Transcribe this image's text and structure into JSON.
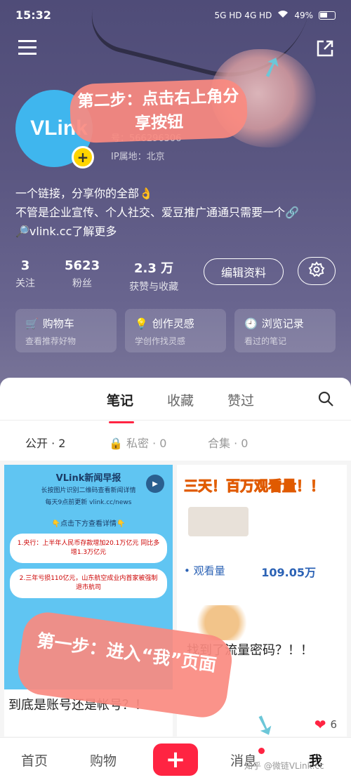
{
  "status_bar": {
    "time": "15:32",
    "network": "5G HD  4G HD",
    "battery": "49%"
  },
  "profile": {
    "avatar_text": "VLink",
    "id_text": "号：566296306",
    "ip_text": "IP属地：北京",
    "bio_lines": [
      "一个链接，分享你的全部👌",
      "不管是企业宣传、个人社交、爱豆推广通通只需要一个🔗",
      "🔎vlink.cc了解更多"
    ],
    "stats": [
      {
        "num": "3",
        "label": "关注"
      },
      {
        "num": "5623",
        "label": "粉丝"
      },
      {
        "num": "2.3 万",
        "label": "获赞与收藏"
      }
    ],
    "edit_label": "编辑资料"
  },
  "cards": [
    {
      "title": "购物车",
      "sub": "查看推荐好物"
    },
    {
      "title": "创作灵感",
      "sub": "学创作找灵感"
    },
    {
      "title": "浏览记录",
      "sub": "看过的笔记"
    }
  ],
  "tabs": [
    {
      "label": "笔记"
    },
    {
      "label": "收藏"
    },
    {
      "label": "赞过"
    }
  ],
  "subtabs": [
    {
      "label": "公开 · 2"
    },
    {
      "label": "🔒 私密 · 0"
    },
    {
      "label": "合集 · 0"
    }
  ],
  "notes": {
    "left": {
      "img_title": "VLink新闻早报",
      "img_sub": "长按图片识别二维码查看新闻详情",
      "img_sub2": "每天9点前更新 vlink.cc/news",
      "img_hint": "👇点击下方查看详情👇",
      "items": [
        "1.央行：上半年人民币存款增加20.1万亿元 同比多增1.3万亿元",
        "2.三年亏损110亿元，山东航空成业内首家被强制退市航司"
      ],
      "title": "到底是账号还是帐号？！"
    },
    "right": {
      "promo": "三天！百万观看量！！",
      "stat_label": "• 观看量",
      "stat_value": "109.05万",
      "title": "找到了流量密码？！！",
      "likes": "6"
    }
  },
  "bottom_nav": [
    {
      "label": "首页"
    },
    {
      "label": "购物"
    },
    {
      "label": "消息"
    },
    {
      "label": "我"
    }
  ],
  "plus_label": "+",
  "watermark": "知乎 @微链VLink.cc",
  "annotations": {
    "step2": "第二步：点击右上角分享按钮",
    "step1": "第一步：进入“我”页面"
  }
}
